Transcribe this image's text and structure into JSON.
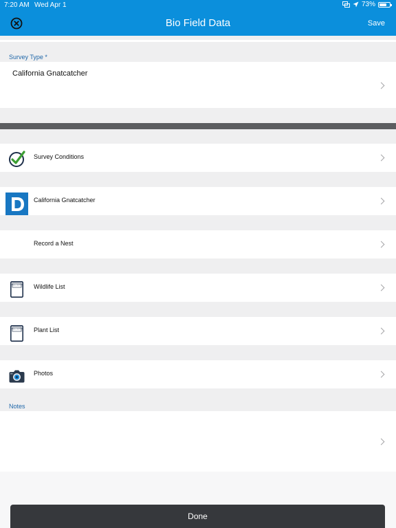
{
  "status_bar": {
    "time": "7:20 AM",
    "date": "Wed Apr 1",
    "battery": "73%",
    "battery_level": 0.73
  },
  "nav": {
    "title": "Bio Field Data",
    "save_label": "Save",
    "close_icon": "close-circle-icon"
  },
  "survey_type": {
    "label": "Survey Type *",
    "value": "California Gnatcatcher"
  },
  "rows": [
    {
      "label": "Survey Conditions",
      "icon": "checkmark-icon"
    },
    {
      "label": "California Gnatcatcher",
      "icon": "d-logo-icon"
    },
    {
      "label": "Record a Nest",
      "icon": ""
    },
    {
      "label": "Wildlife List",
      "icon": "field-notes-icon",
      "icon_text": "FIELD NOTES"
    },
    {
      "label": "Plant List",
      "icon": "field-notes-icon",
      "icon_text": "FIELD NOTES"
    },
    {
      "label": "Photos",
      "icon": "camera-icon"
    }
  ],
  "notes": {
    "label": "Notes",
    "value": ""
  },
  "done_label": "Done",
  "colors": {
    "accent": "#0b8fdc",
    "label_blue": "#1f67a9",
    "check_green": "#3c9e33",
    "d_logo_blue": "#1877c2",
    "done_bg": "#36383c"
  }
}
